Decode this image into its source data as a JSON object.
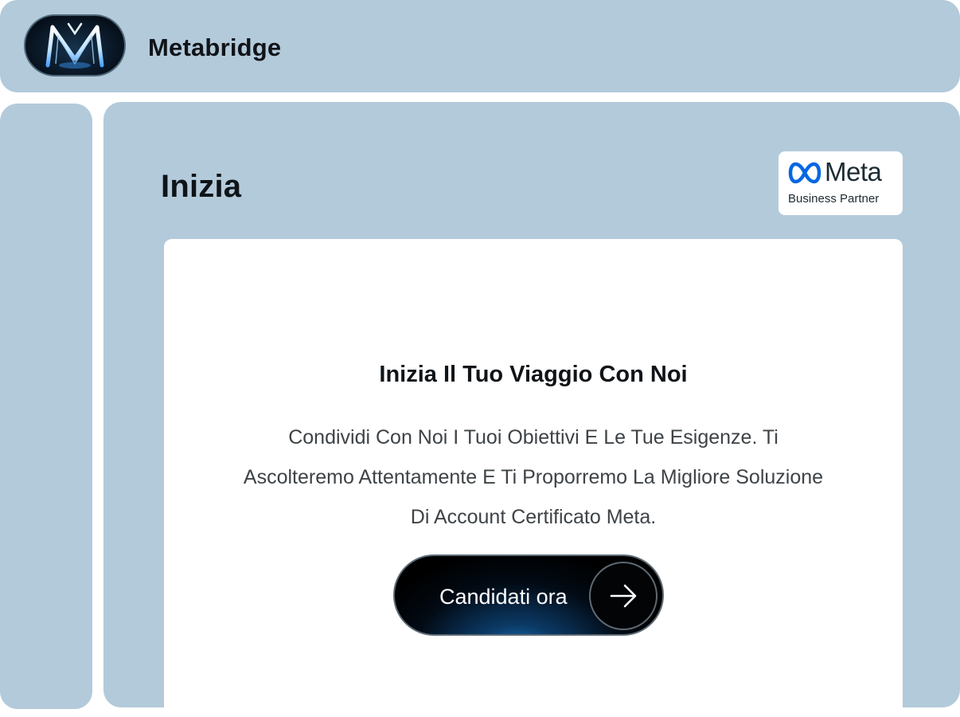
{
  "header": {
    "brand_name": "Metabridge",
    "logo_icon": "metabridge-m-logo-icon"
  },
  "main": {
    "page_title": "Inizia",
    "partner_badge": {
      "icon": "meta-infinity-logo-icon",
      "wordmark": "Meta",
      "subtitle": "Business Partner",
      "accent_color": "#0668e1"
    },
    "card": {
      "title": "Inizia Il Tuo Viaggio Con Noi",
      "body": "Condividi Con Noi I Tuoi Obiettivi E Le Tue Esigenze. Ti Ascolteremo Attentamente E Ti Proporremo La Migliore Soluzione Di Account Certificato Meta.",
      "cta": {
        "label": "Candidati ora",
        "icon": "arrow-right-icon"
      }
    }
  },
  "colors": {
    "panel_background": "#b3cadb",
    "card_background": "#ffffff",
    "text_dark": "#101418",
    "body_text": "#3e4347",
    "cta_background": "#000000",
    "cta_glow": "#1d7fd0"
  }
}
